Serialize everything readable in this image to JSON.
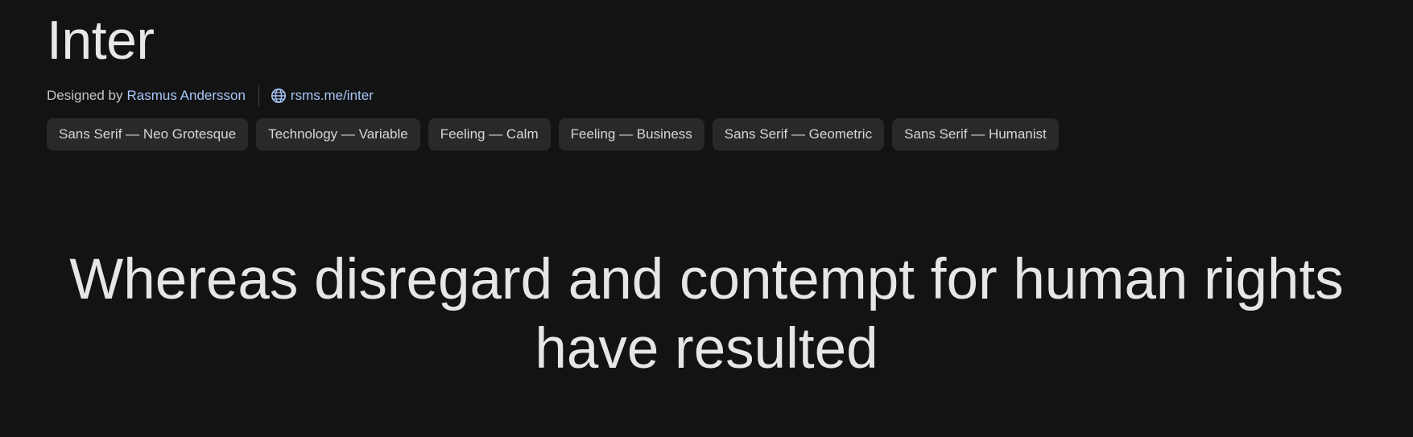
{
  "font": {
    "name": "Inter",
    "designed_by_label": "Designed by",
    "designer": "Rasmus Andersson",
    "website": "rsms.me/inter",
    "website_icon": "globe-icon"
  },
  "tags": [
    "Sans Serif — Neo Grotesque",
    "Technology — Variable",
    "Feeling — Calm",
    "Feeling — Business",
    "Sans Serif — Geometric",
    "Sans Serif — Humanist"
  ],
  "sample_text": "Whereas disregard and contempt for human rights have resulted",
  "colors": {
    "background": "#131313",
    "link": "#a8c7fa",
    "tag_background": "#28292a"
  }
}
